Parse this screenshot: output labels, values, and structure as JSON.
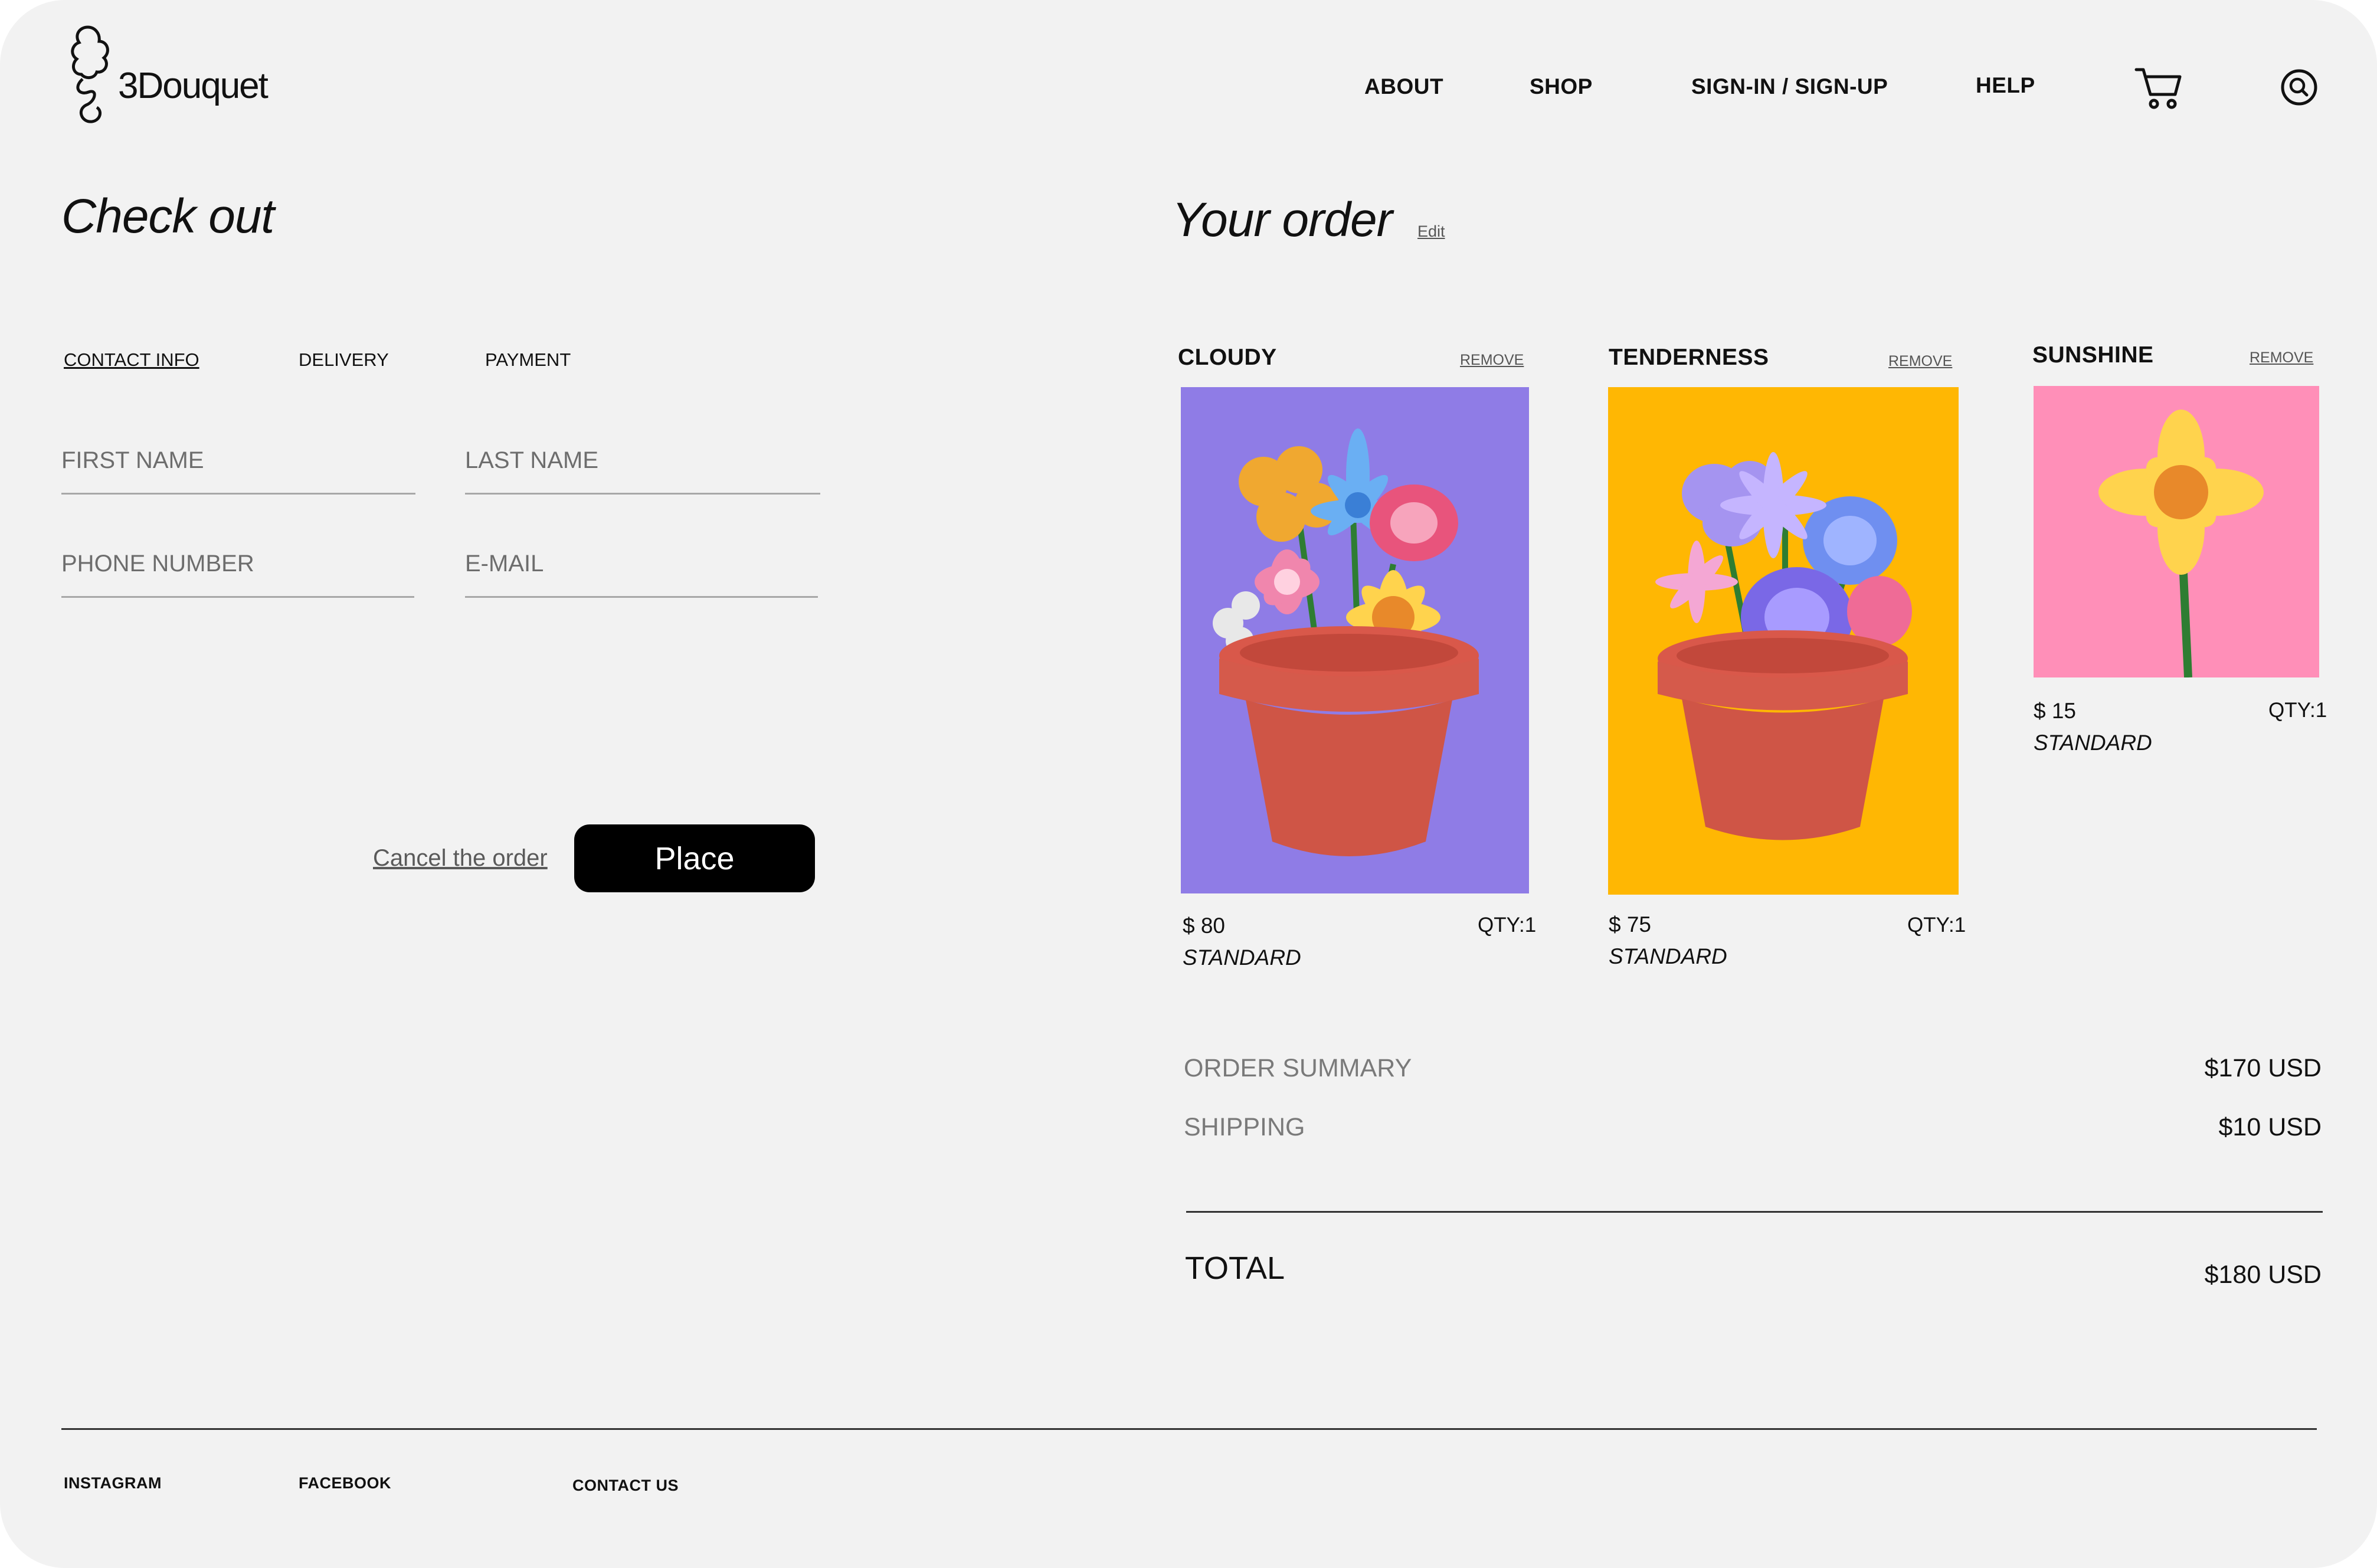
{
  "brand": {
    "name": "3Douquet"
  },
  "nav": {
    "about": "ABOUT",
    "shop": "SHOP",
    "signin": "SIGN-IN / SIGN-UP",
    "help": "HELP"
  },
  "checkout": {
    "title": "Check out",
    "steps": [
      "CONTACT INFO",
      "DELIVERY",
      "PAYMENT"
    ],
    "fields": {
      "first_name": {
        "placeholder": "FIRST NAME",
        "value": ""
      },
      "last_name": {
        "placeholder": "LAST NAME",
        "value": ""
      },
      "phone": {
        "placeholder": "PHONE NUMBER",
        "value": ""
      },
      "email": {
        "placeholder": "E-MAIL",
        "value": ""
      }
    },
    "cancel_label": "Cancel the order ",
    "place_label": "Place"
  },
  "order": {
    "title": "Your order",
    "edit_label": "Edit",
    "items": [
      {
        "name": "CLOUDY",
        "remove": "REMOVE",
        "price": "$ 80",
        "qty": "QTY:1",
        "style": "STANDARD",
        "bg": "#8f7ce6"
      },
      {
        "name": "TENDERNESS",
        "remove": "REMOVE",
        "price": "$ 75",
        "qty": "QTY:1",
        "style": "STANDARD",
        "bg": "#ffb703"
      },
      {
        "name": "SUNSHINE",
        "remove": "REMOVE",
        "price": "$ 15",
        "qty": "QTY:1",
        "style": "STANDARD",
        "bg": "#ff8fb8"
      }
    ],
    "summary": {
      "order_label": "ORDER SUMMARY",
      "order_value": "$170 USD",
      "shipping_label": "SHIPPING",
      "shipping_value": "$10 USD",
      "total_label": "TOTAL",
      "total_value": "$180 USD"
    }
  },
  "footer": {
    "instagram": "INSTAGRAM",
    "facebook": "FACEBOOK",
    "contact": "CONTACT US"
  },
  "icons": {
    "cart": "cart-icon",
    "search": "search-icon",
    "logo": "bouquet-logo-icon"
  }
}
